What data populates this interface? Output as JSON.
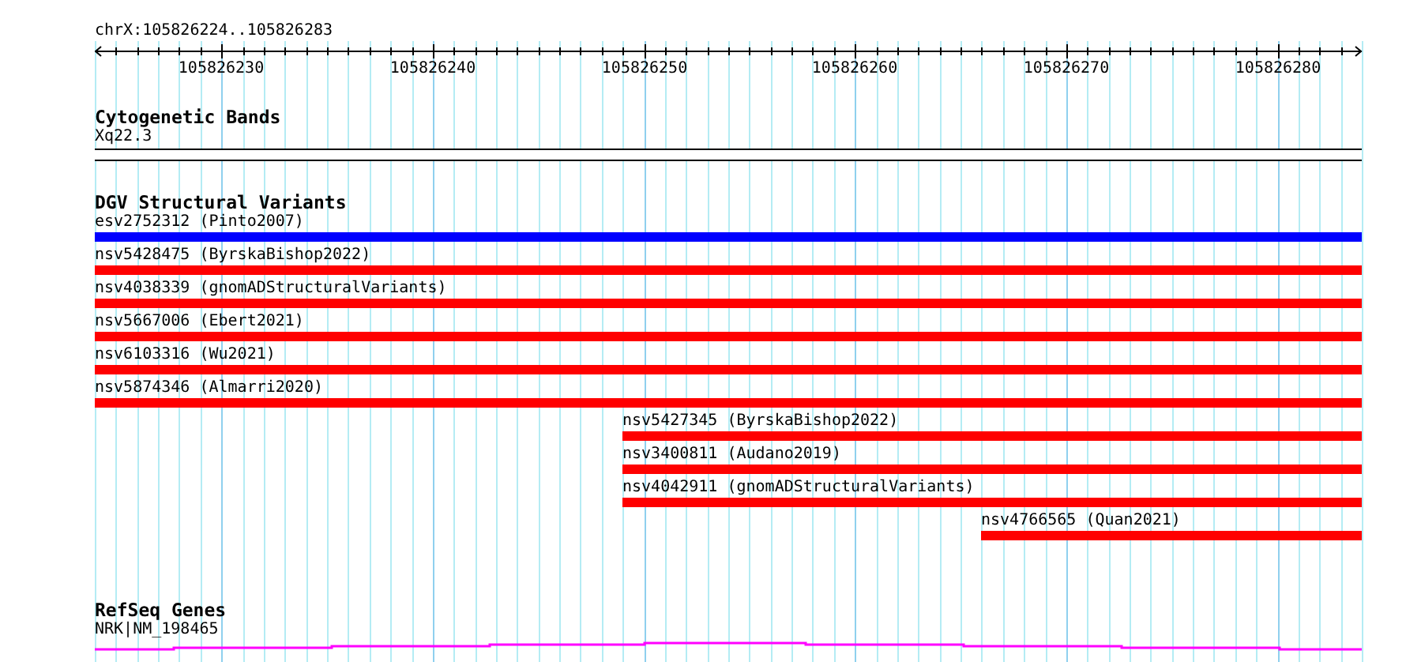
{
  "locus": "chrX:105826224..105826283",
  "ruler": {
    "ticks": [
      "105826230",
      "105826240",
      "105826250",
      "105826260",
      "105826270",
      "105826280"
    ]
  },
  "tracks": [
    {
      "title": "Cytogenetic Bands",
      "kind": "bands",
      "features": [
        {
          "label": "Xq22.3"
        }
      ]
    },
    {
      "title": "DGV Structural Variants",
      "kind": "variants",
      "features": [
        {
          "label": "esv2752312 (Pinto2007)",
          "color": "#0000ff"
        },
        {
          "label": "nsv5428475 (ByrskaBishop2022)",
          "color": "#ff0000"
        },
        {
          "label": "nsv4038339 (gnomADStructuralVariants)",
          "color": "#ff0000"
        },
        {
          "label": "nsv5667006 (Ebert2021)",
          "color": "#ff0000"
        },
        {
          "label": "nsv6103316 (Wu2021)",
          "color": "#ff0000"
        },
        {
          "label": "nsv5874346 (Almarri2020)",
          "color": "#ff0000"
        },
        {
          "label": "nsv5427345 (ByrskaBishop2022)",
          "color": "#ff0000",
          "level": 0.584
        },
        {
          "label": "nsv3400811 (Audano2019)",
          "color": "#ff0000",
          "level": 0.584
        },
        {
          "label": "nsv4042911 (gnomADStructuralVariants)",
          "color": "#ff0000",
          "level": 0.584
        },
        {
          "label": "nsv4766565 (Quan2021)",
          "color": "#ff0000",
          "level": 0.3
        }
      ]
    },
    {
      "title": "RefSeq Genes",
      "kind": "genes",
      "features": [
        {
          "label": "NRK|NM_198465"
        }
      ]
    }
  ]
}
